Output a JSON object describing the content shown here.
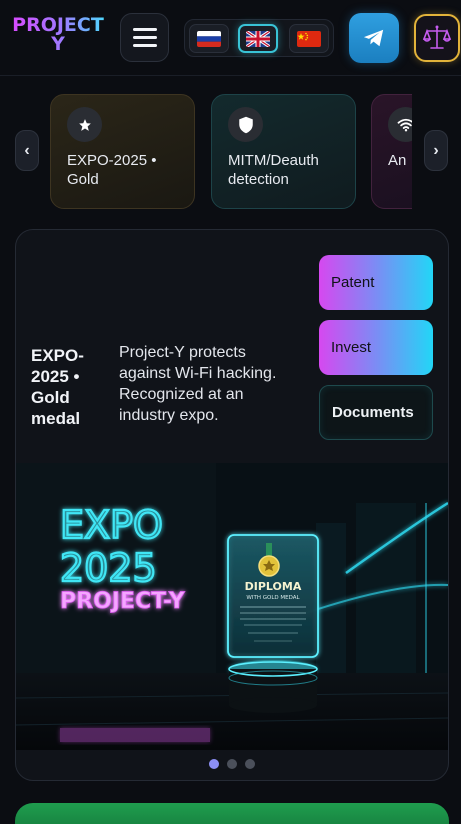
{
  "header": {
    "logo_line1": "PROJECT",
    "logo_line2": "Y",
    "languages": [
      {
        "code": "ru",
        "icon": "russia-flag-icon",
        "active": false
      },
      {
        "code": "en",
        "icon": "uk-flag-icon",
        "active": true
      },
      {
        "code": "zh",
        "icon": "china-flag-icon",
        "active": false
      }
    ],
    "telegram_icon": "telegram-icon",
    "legal_icon": "scales-icon"
  },
  "chips": [
    {
      "label": "EXPO-2025 • Gold",
      "icon": "star-icon"
    },
    {
      "label": "MITM/Deauth detection",
      "icon": "shield-icon"
    },
    {
      "label": "An",
      "icon": "wifi-icon"
    }
  ],
  "card": {
    "title": "EXPO-2025 • Gold medal",
    "description": "Project-Y protects against Wi-Fi hacking. Recognized at an industry expo.",
    "buttons": {
      "patent": "Patent",
      "invest": "Invest",
      "documents": "Documents"
    },
    "image": {
      "neon_line1": "EXPO",
      "neon_line2": "2025",
      "neon_line3": "PROJECT-Y",
      "diploma_title": "DIPLOMA",
      "diploma_subtitle": "WITH GOLD MEDAL"
    },
    "slides_total": 3,
    "slide_active": 1
  },
  "colors": {
    "background": "#0b0d12",
    "accent_pink": "#d648f0",
    "accent_cyan": "#22d6f6",
    "telegram": "#2f9fe0",
    "gold": "#e2b33a"
  }
}
